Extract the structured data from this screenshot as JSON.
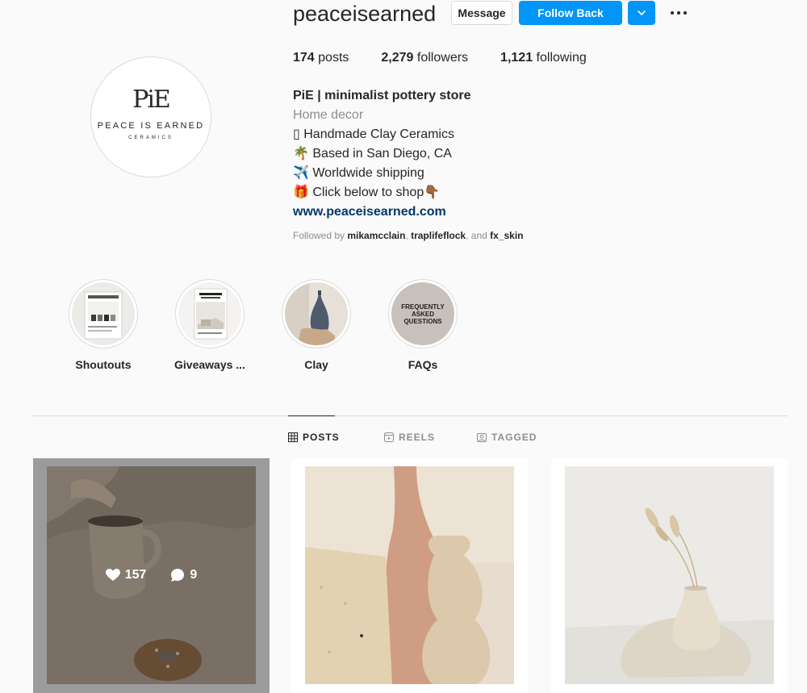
{
  "profile": {
    "username": "peaceisearned",
    "logo_mark": "PiE",
    "logo_name": "PEACE IS EARNED",
    "logo_sub": "CERAMICS",
    "buttons": {
      "message": "Message",
      "follow_back": "Follow Back"
    },
    "stats": {
      "posts_count": "174",
      "posts_label": "posts",
      "followers_count": "2,279",
      "followers_label": "followers",
      "following_count": "1,121",
      "following_label": "following"
    },
    "bio": {
      "name": "PiE | minimalist pottery store",
      "category": "Home decor",
      "line1": "▯ Handmade Clay Ceramics",
      "line2": "🌴 Based in San Diego, CA",
      "line3": "✈️ Worldwide shipping",
      "line4": "🎁 Click below to shop👇🏾",
      "website": "www.peaceisearned.com"
    },
    "followed_by": {
      "prefix": "Followed by",
      "user1": "mikamcclain",
      "user2": "traplifeflock",
      "joiner": ", and",
      "user3": "fx_skin"
    }
  },
  "highlights": [
    {
      "label": "Shoutouts"
    },
    {
      "label": "Giveaways ..."
    },
    {
      "label": "Clay"
    },
    {
      "label": "FAQs",
      "cover_text": "FREQUENTLY ASKED QUESTIONS"
    }
  ],
  "tabs": [
    {
      "label": "POSTS",
      "icon": "grid-icon",
      "active": true
    },
    {
      "label": "REELS",
      "icon": "reels-icon",
      "active": false
    },
    {
      "label": "TAGGED",
      "icon": "tagged-icon",
      "active": false
    }
  ],
  "posts": [
    {
      "likes": "157",
      "comments": "9",
      "hovered": true
    },
    {
      "hovered": false
    },
    {
      "hovered": false
    }
  ],
  "colors": {
    "accent": "#0095f6",
    "link": "#00376b",
    "muted": "#8e8e8e",
    "text": "#262626"
  }
}
